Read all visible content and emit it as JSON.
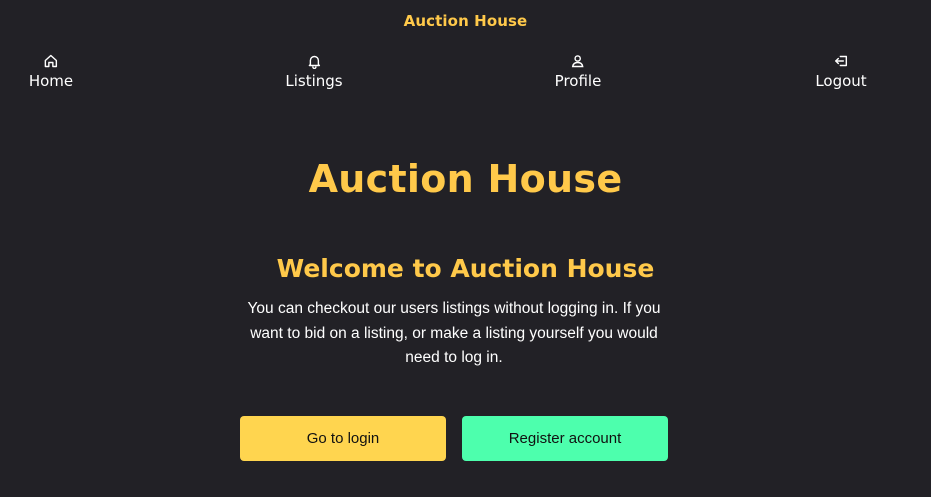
{
  "header": {
    "title": "Auction House"
  },
  "nav": {
    "items": [
      {
        "label": "Home",
        "icon": "home-icon"
      },
      {
        "label": "Listings",
        "icon": "bell-icon"
      },
      {
        "label": "Profile",
        "icon": "user-icon"
      },
      {
        "label": "Logout",
        "icon": "logout-icon"
      }
    ]
  },
  "main": {
    "title": "Auction House",
    "welcome_title": "Welcome to Auction House",
    "welcome_text": "You can checkout our users listings without logging in. If you want to bid on a listing, or make a listing yourself you would need to log in.",
    "login_button": "Go to login",
    "register_button": "Register account"
  },
  "colors": {
    "background": "#222126",
    "accent": "#ffc94a",
    "login_button": "#ffd54f",
    "register_button": "#4dffad",
    "text": "#ffffff"
  }
}
